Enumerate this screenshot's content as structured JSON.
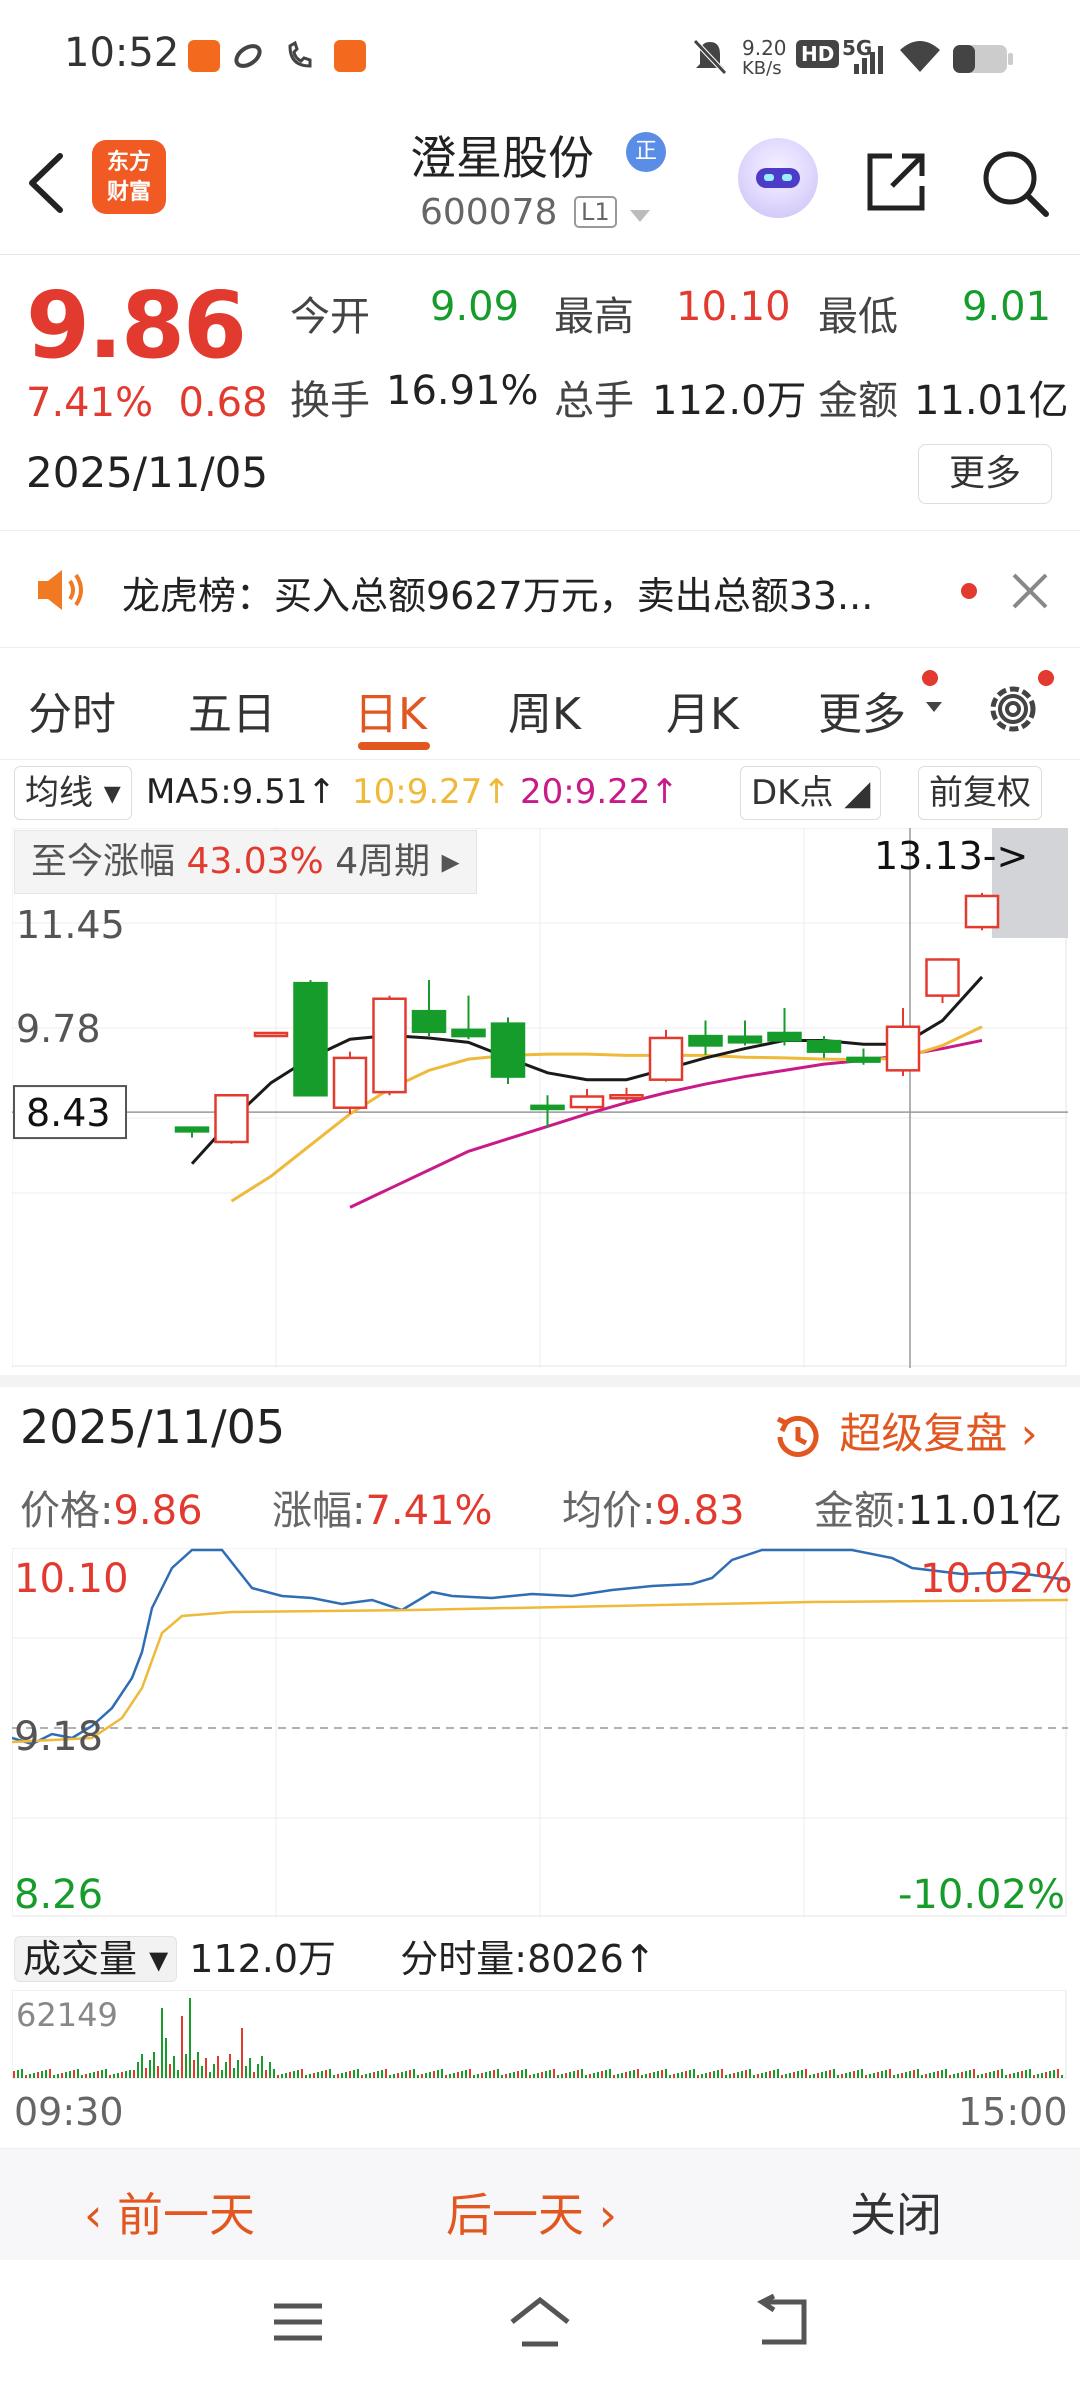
{
  "status_bar": {
    "time": "10:52",
    "net_speed": "9.20",
    "net_unit": "KB/s",
    "hd": "HD",
    "signal": "5G"
  },
  "header": {
    "logo_text_1": "东方",
    "logo_text_2": "财富",
    "stock_name": "澄星股份",
    "badge": "正",
    "stock_code": "600078",
    "level": "L1"
  },
  "quote": {
    "price": "9.86",
    "change_pct": "7.41%",
    "change_amt": "0.68",
    "date": "2025/11/05",
    "open_label": "今开",
    "open": "9.09",
    "high_label": "最高",
    "high": "10.10",
    "low_label": "最低",
    "low": "9.01",
    "turnover_label": "换手",
    "turnover": "16.91%",
    "volume_label": "总手",
    "volume": "112.0万",
    "amount_label": "金额",
    "amount": "11.01亿",
    "more_label": "更多"
  },
  "notice": {
    "text": "龙虎榜：买入总额9627万元，卖出总额33..."
  },
  "tabs": [
    {
      "label": "分时"
    },
    {
      "label": "五日"
    },
    {
      "label": "日K"
    },
    {
      "label": "周K"
    },
    {
      "label": "月K"
    },
    {
      "label": "更多"
    }
  ],
  "ma_bar": {
    "ma_select": "均线",
    "ma5": "MA5:9.51↑",
    "ma10": "10:9.27↑",
    "ma20": "20:9.22↑",
    "dk": "DK点",
    "adjust": "前复权"
  },
  "kline": {
    "gain_label": "至今涨幅",
    "gain_value": "43.03%",
    "gain_period": "4周期",
    "top_tag": "13.13->",
    "price_labels": [
      "11.45",
      "9.78",
      "8.43"
    ],
    "price_labels_values": [
      11.45,
      9.78,
      8.43
    ],
    "candles": [
      {
        "o": 8.18,
        "c": 8.12,
        "h": 8.2,
        "l": 8.02
      },
      {
        "o": 7.95,
        "c": 8.7,
        "h": 8.72,
        "l": 7.92
      },
      {
        "o": 9.7,
        "c": 9.7,
        "h": 9.7,
        "l": 9.7
      },
      {
        "o": 10.5,
        "c": 8.7,
        "h": 10.55,
        "l": 8.68
      },
      {
        "o": 8.5,
        "c": 9.3,
        "h": 9.4,
        "l": 8.4
      },
      {
        "o": 8.75,
        "c": 10.25,
        "h": 10.3,
        "l": 8.7
      },
      {
        "o": 10.05,
        "c": 9.72,
        "h": 10.55,
        "l": 9.65
      },
      {
        "o": 9.75,
        "c": 9.65,
        "h": 10.3,
        "l": 9.6
      },
      {
        "o": 9.85,
        "c": 9.0,
        "h": 9.95,
        "l": 8.88
      },
      {
        "o": 8.53,
        "c": 8.48,
        "h": 8.7,
        "l": 8.18
      },
      {
        "o": 8.51,
        "c": 8.68,
        "h": 8.8,
        "l": 8.45
      },
      {
        "o": 8.68,
        "c": 8.7,
        "h": 8.82,
        "l": 8.6
      },
      {
        "o": 8.95,
        "c": 9.62,
        "h": 9.75,
        "l": 8.92
      },
      {
        "o": 9.65,
        "c": 9.5,
        "h": 9.9,
        "l": 9.35
      },
      {
        "o": 9.64,
        "c": 9.55,
        "h": 9.9,
        "l": 9.5
      },
      {
        "o": 9.7,
        "c": 9.58,
        "h": 10.1,
        "l": 9.5
      },
      {
        "o": 9.57,
        "c": 9.4,
        "h": 9.65,
        "l": 9.3
      },
      {
        "o": 9.3,
        "c": 9.24,
        "h": 9.45,
        "l": 9.19
      },
      {
        "o": 9.1,
        "c": 9.8,
        "h": 10.1,
        "l": 9.01
      },
      {
        "o": 10.3,
        "c": 10.88,
        "h": 10.9,
        "l": 10.18
      },
      {
        "o": 11.4,
        "c": 11.9,
        "h": 11.95,
        "l": 11.35
      }
    ],
    "ma5": [
      7.6,
      8.3,
      8.9,
      9.3,
      9.6,
      9.66,
      9.62,
      9.55,
      9.3,
      9.06,
      8.95,
      8.95,
      9.12,
      9.3,
      9.45,
      9.58,
      9.58,
      9.52,
      9.52,
      9.9,
      10.6
    ],
    "ma10": [
      null,
      7.0,
      7.4,
      7.9,
      8.4,
      8.8,
      9.1,
      9.28,
      9.34,
      9.36,
      9.36,
      9.34,
      9.34,
      9.34,
      9.31,
      9.3,
      9.28,
      9.27,
      9.3,
      9.5,
      9.8
    ],
    "ma20": [
      null,
      null,
      null,
      null,
      6.9,
      7.2,
      7.5,
      7.8,
      8.0,
      8.2,
      8.4,
      8.58,
      8.74,
      8.88,
      9.0,
      9.1,
      9.2,
      9.26,
      9.34,
      9.45,
      9.58
    ]
  },
  "minute": {
    "date": "2025/11/05",
    "replay_label": "超级复盘",
    "price_label": "价格:",
    "price": "9.86",
    "change_label": "涨幅:",
    "change": "7.41%",
    "avg_label": "均价:",
    "avg": "9.83",
    "amount_label": "金额:",
    "amount": "11.01亿",
    "upper_price": "10.10",
    "upper_pct": "10.02%",
    "ref_price": "9.18",
    "lower_price": "8.26",
    "lower_pct": "-10.02%",
    "vol_select": "成交量",
    "vol_total": "112.0万",
    "vol_now_label": "分时量:",
    "vol_now": "8026↑",
    "vol_max": "62149",
    "start_time": "09:30",
    "end_time": "15:00"
  },
  "day_nav": {
    "prev": "前一天",
    "next": "后一天",
    "close": "关闭"
  },
  "colors": {
    "up": "#e23a2e",
    "down": "#169c2a",
    "accent": "#e2561f",
    "ma5": "#1a1a1a",
    "ma10": "#efb93a",
    "ma20": "#c81a88",
    "intraday": "#2f6db5"
  }
}
